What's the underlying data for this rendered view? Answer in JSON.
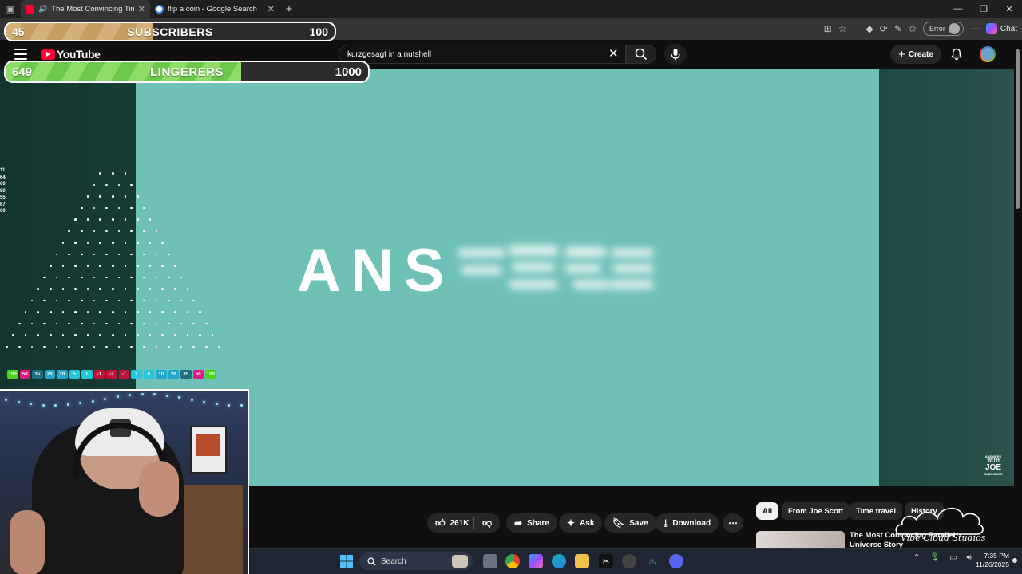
{
  "browser": {
    "tabs": [
      {
        "title": "The Most Convincing Time T",
        "active": true,
        "favicon": "youtube-favicon",
        "audio": true
      },
      {
        "title": "flip a coin - Google Search",
        "active": false,
        "favicon": "google-favicon",
        "audio": false
      }
    ],
    "new_tab_icon": "plus-icon",
    "profile_status": "Error",
    "chat_label": "Chat"
  },
  "overlays": {
    "subscribers": {
      "current": "45",
      "label": "SUBSCRIBERS",
      "goal": "100",
      "progress": 0.45
    },
    "lingerers": {
      "current": "649",
      "label": "LINGERERS",
      "goal": "1000",
      "progress": 0.649
    }
  },
  "youtube": {
    "logo_text": "YouTube",
    "search_value": "kurzgesagt in a nutshell",
    "create_label": "Create",
    "accent": "#ff0033"
  },
  "video": {
    "frame_text": "ANS",
    "background": "#6fc1b8",
    "watermark_lines": [
      "ANSWERS",
      "WITH",
      "JOE",
      "SUBSCRIBE"
    ]
  },
  "plinko": {
    "odds": [
      "11",
      "64",
      "60",
      "80",
      "55",
      "67",
      "00"
    ],
    "slots": [
      {
        "v": "100",
        "c": "#4ad41c"
      },
      {
        "v": "50",
        "c": "#e0197f"
      },
      {
        "v": "35",
        "c": "#1f6f7f"
      },
      {
        "v": "20",
        "c": "#1fa6c9"
      },
      {
        "v": "10",
        "c": "#1fa6c9"
      },
      {
        "v": "5",
        "c": "#26c6d9"
      },
      {
        "v": "1",
        "c": "#26c6d9"
      },
      {
        "v": "-1",
        "c": "#c1123a"
      },
      {
        "v": "-2",
        "c": "#c1123a"
      },
      {
        "v": "-1",
        "c": "#c1123a"
      },
      {
        "v": "1",
        "c": "#26c6d9"
      },
      {
        "v": "5",
        "c": "#26c6d9"
      },
      {
        "v": "10",
        "c": "#1fa6c9"
      },
      {
        "v": "20",
        "c": "#1fa6c9"
      },
      {
        "v": "35",
        "c": "#1f6f7f"
      },
      {
        "v": "50",
        "c": "#e0197f"
      },
      {
        "v": "100",
        "c": "#4ad41c"
      }
    ]
  },
  "actions": {
    "likes": "261K",
    "share": "Share",
    "ask": "Ask",
    "save": "Save",
    "download": "Download"
  },
  "recommendations": {
    "chips": [
      "All",
      "From Joe Scott",
      "Time travel",
      "History"
    ],
    "first_title": "The Most Convincing Parallel Universe Story"
  },
  "branding": {
    "studio": "Vibe Cloud Studios"
  },
  "taskbar": {
    "search_label": "Search",
    "time": "7:35 PM",
    "date": "11/26/2025"
  }
}
